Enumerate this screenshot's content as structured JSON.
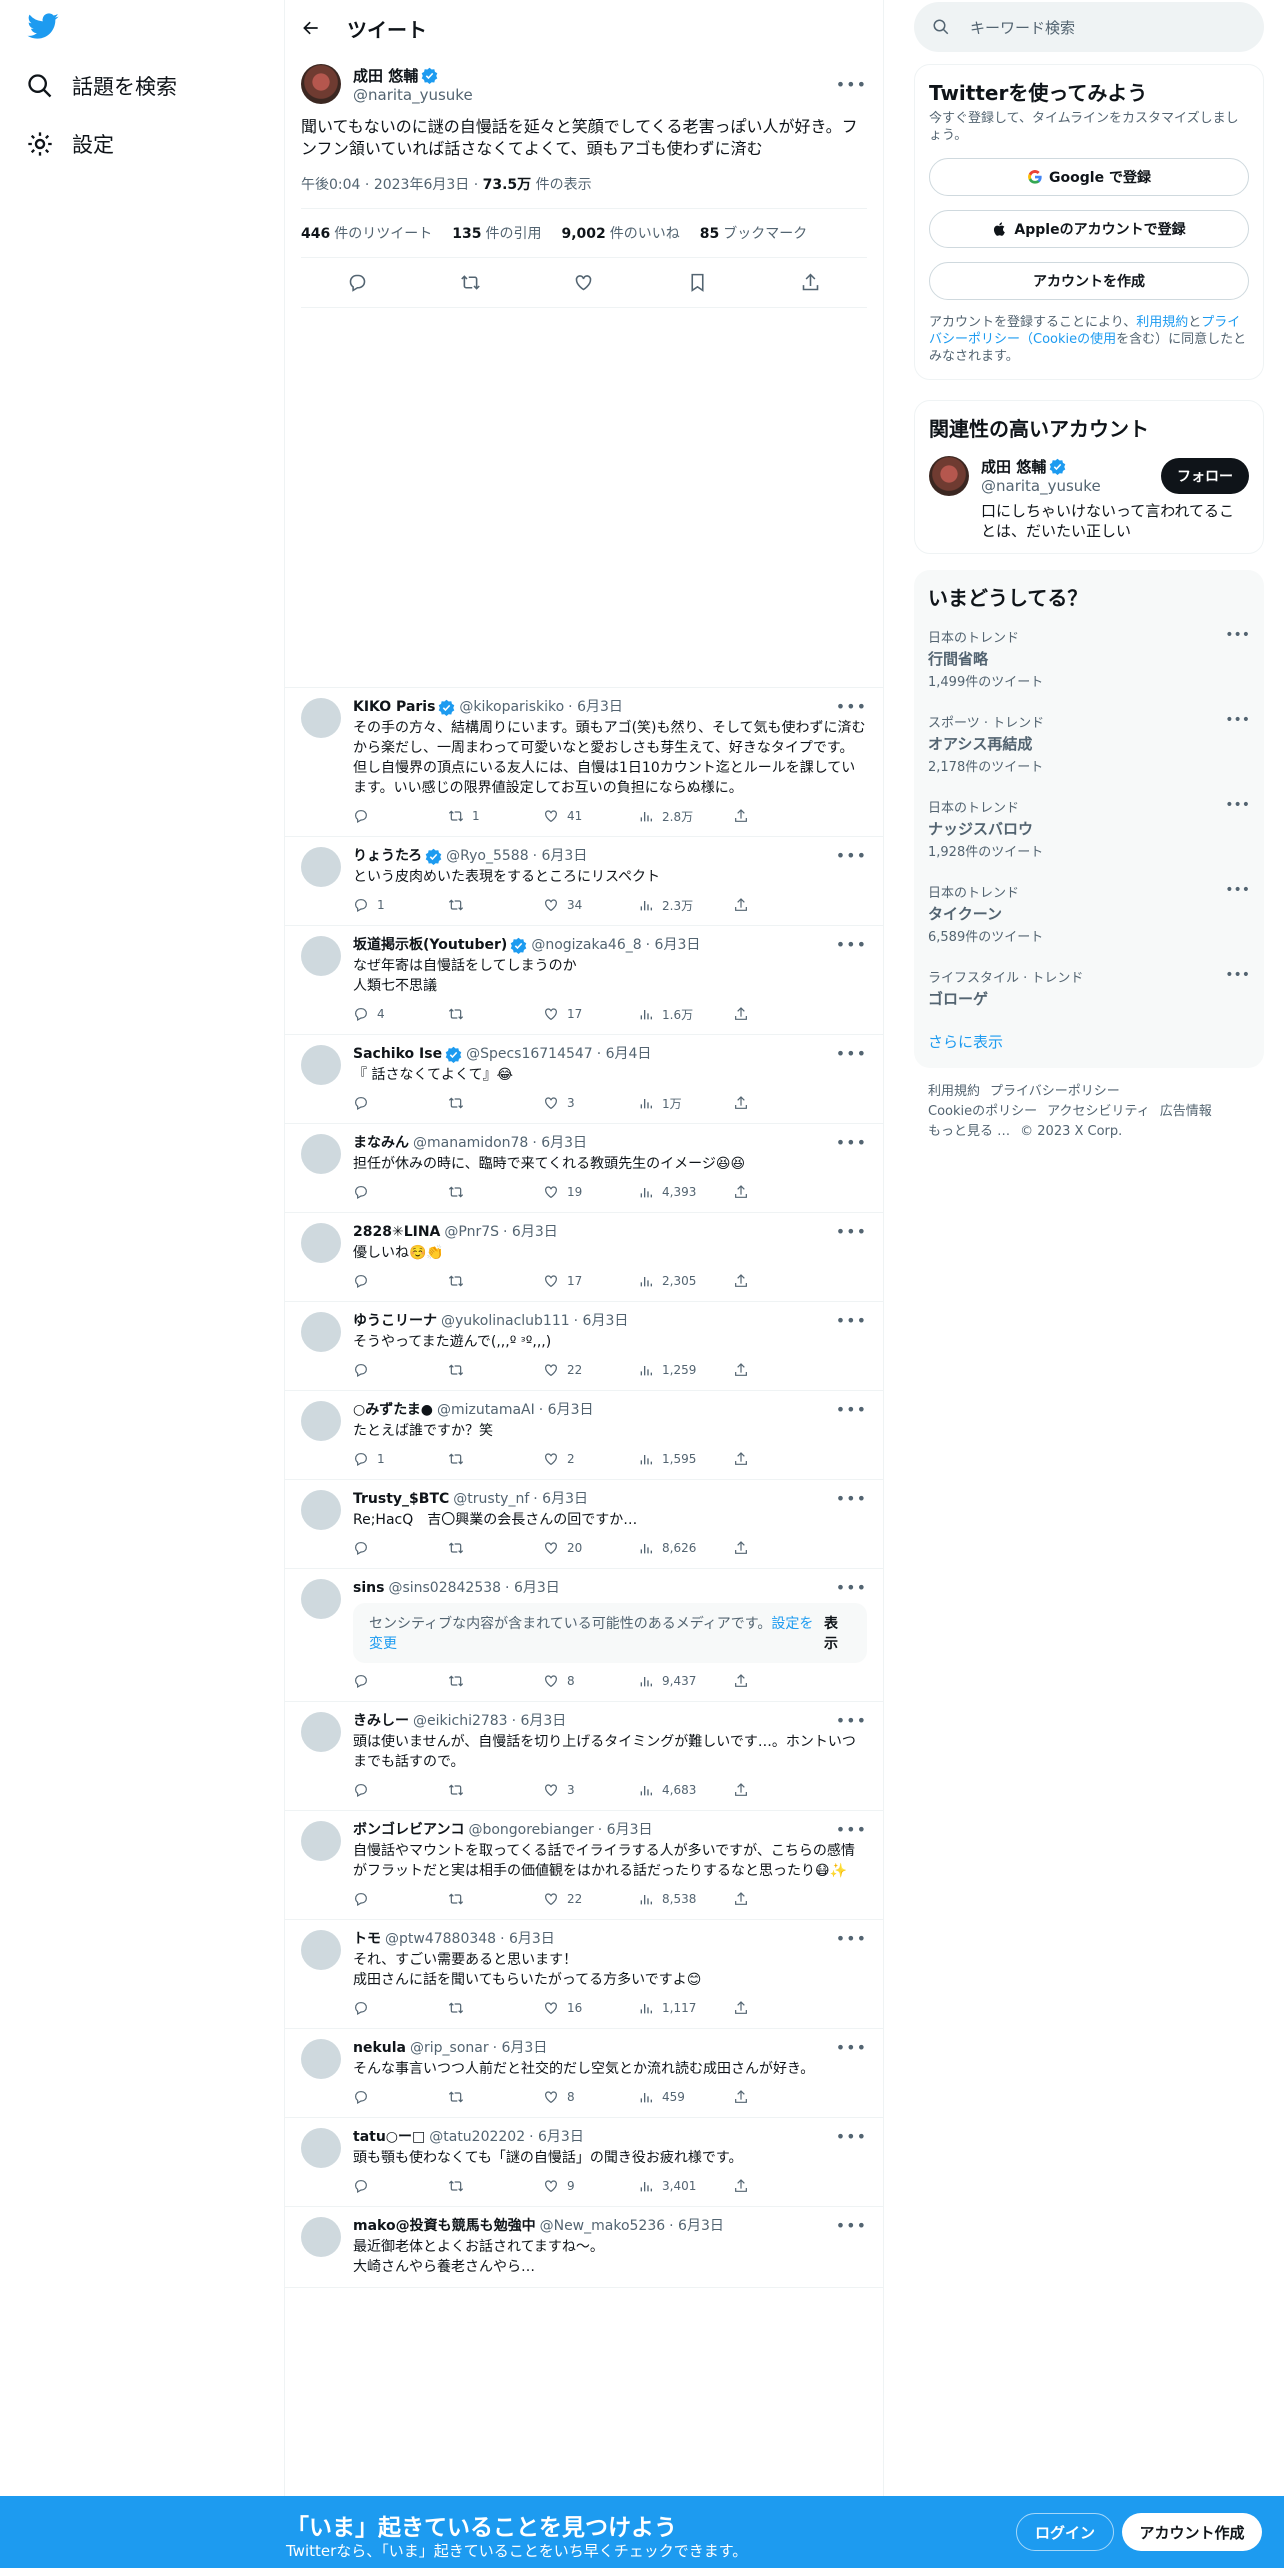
{
  "nav": {
    "explore": "話題を検索",
    "settings": "設定"
  },
  "header": {
    "title": "ツイート"
  },
  "tweet": {
    "name": "成田 悠輔",
    "handle": "@narita_yusuke",
    "text": "聞いてもないのに謎の自慢話を延々と笑顔でしてくる老害っぽい人が好き。フンフン頷いていれば話さなくてよくて、頭もアゴも使わずに済む",
    "time": "午後0:04",
    "date": "2023年6月3日",
    "views": "73.5万",
    "views_label": "件の表示",
    "retweets": "446",
    "retweets_label": "件のリツイート",
    "quotes": "135",
    "quotes_label": "件の引用",
    "likes": "9,002",
    "likes_label": "件のいいね",
    "bookmarks": "85",
    "bookmarks_label": "ブックマーク"
  },
  "replies": [
    {
      "name": "KIKO Paris",
      "verified": true,
      "handle": "@kikopariskiko",
      "date": "· 6月3日",
      "text": "その手の方々、結構周りにいます。頭もアゴ(笑)も然り、そして気も使わずに済むから楽だし、一周まわって可愛いなと愛おしさも芽生えて、好きなタイプです。\n但し自慢界の頂点にいる友人には、自慢は1日10カウント迄とルールを課しています。いい感じの限界値設定してお互いの負担にならぬ様に。",
      "replies": "",
      "retweets": "1",
      "likes": "41",
      "views": "2.8万"
    },
    {
      "name": "りょうたろ",
      "verified": true,
      "handle": "@Ryo_5588",
      "date": "· 6月3日",
      "text": "という皮肉めいた表現をするところにリスペクト",
      "replies": "1",
      "retweets": "",
      "likes": "34",
      "views": "2.3万"
    },
    {
      "name": "坂道掲示板(Youtuber)",
      "verified": true,
      "handle": "@nogizaka46_8",
      "date": "· 6月3日",
      "text": "なぜ年寄は自慢話をしてしまうのか\n人類七不思議",
      "replies": "4",
      "retweets": "",
      "likes": "17",
      "views": "1.6万"
    },
    {
      "name": "Sachiko Ise",
      "verified": true,
      "handle": "@Specs16714547",
      "date": "· 6月4日",
      "text": "『 話さなくてよくて』😂",
      "replies": "",
      "retweets": "",
      "likes": "3",
      "views": "1万"
    },
    {
      "name": "まなみん",
      "verified": false,
      "handle": "@manamidon78",
      "date": "· 6月3日",
      "text": "担任が休みの時に、臨時で来てくれる教頭先生のイメージ😆😆",
      "replies": "",
      "retweets": "",
      "likes": "19",
      "views": "4,393"
    },
    {
      "name": "2828✳LINA",
      "verified": false,
      "handle": "@Pnr7S",
      "date": "· 6月3日",
      "text": "優しいね☺️👏",
      "replies": "",
      "retweets": "",
      "likes": "17",
      "views": "2,305"
    },
    {
      "name": "ゆうこリーナ",
      "verified": false,
      "handle": "@yukolinaclub111",
      "date": "· 6月3日",
      "text": "そうやってまた遊んで(,,,º ᵌº,,,)",
      "replies": "",
      "retweets": "",
      "likes": "22",
      "views": "1,259"
    },
    {
      "name": "○みずたま●",
      "verified": false,
      "handle": "@mizutamaAI",
      "date": "· 6月3日",
      "text": "たとえば誰ですか？笑",
      "replies": "1",
      "retweets": "",
      "likes": "2",
      "views": "1,595"
    },
    {
      "name": "Trusty_$BTC",
      "verified": false,
      "handle": "@trusty_nf",
      "date": "· 6月3日",
      "text": "Re;HacQ　吉〇興業の会長さんの回ですか…",
      "replies": "",
      "retweets": "",
      "likes": "20",
      "views": "8,626"
    },
    {
      "name": "sins",
      "verified": false,
      "handle": "@sins02842538",
      "date": "· 6月3日",
      "text": "",
      "sensitive": {
        "text1": "センシティブな内容が含まれている可能性のあるメディアです。",
        "link": "設定を変更",
        "show": "表示"
      },
      "replies": "",
      "retweets": "",
      "likes": "8",
      "views": "9,437"
    },
    {
      "name": "きみしー",
      "verified": false,
      "handle": "@eikichi2783",
      "date": "· 6月3日",
      "text": "頭は使いませんが、自慢話を切り上げるタイミングが難しいです…。ホントいつまでも話すので。",
      "replies": "",
      "retweets": "",
      "likes": "3",
      "views": "4,683"
    },
    {
      "name": "ボンゴレビアンコ",
      "verified": false,
      "handle": "@bongorebianger",
      "date": "· 6月3日",
      "text": "自慢話やマウントを取ってくる話でイライラする人が多いですが、こちらの感情がフラットだと実は相手の価値観をはかれる話だったりするなと思ったり😷✨",
      "replies": "",
      "retweets": "",
      "likes": "22",
      "views": "8,538"
    },
    {
      "name": "トモ",
      "verified": false,
      "handle": "@ptw47880348",
      "date": "· 6月3日",
      "text": "それ、すごい需要あると思います！\n成田さんに話を聞いてもらいたがってる方多いですよ😊",
      "replies": "",
      "retweets": "",
      "likes": "16",
      "views": "1,117"
    },
    {
      "name": "nekula",
      "verified": false,
      "handle": "@rip_sonar",
      "date": "· 6月3日",
      "text": "そんな事言いつつ人前だと社交的だし空気とか流れ読む成田さんが好き。",
      "replies": "",
      "retweets": "",
      "likes": "8",
      "views": "459"
    },
    {
      "name": "tatu○ー□",
      "verified": false,
      "handle": "@tatu202202",
      "date": "· 6月3日",
      "text": "頭も顎も使わなくても「謎の自慢話」の聞き役お疲れ様です。",
      "replies": "",
      "retweets": "",
      "likes": "9",
      "views": "3,401"
    },
    {
      "name": "mako@投資も競馬も勉強中",
      "verified": false,
      "handle": "@New_mako5236",
      "date": "· 6月3日",
      "text": "最近御老体とよくお話されてますね〜。\n大崎さんやら養老さんやら…",
      "replies": "",
      "retweets": "",
      "likes": "",
      "views": ""
    }
  ],
  "sidebar": {
    "search_placeholder": "キーワード検索",
    "signup": {
      "title": "Twitterを使ってみよう",
      "subtitle": "今すぐ登録して、タイムラインをカスタマイズしましょう。",
      "google": "Google で登録",
      "apple": "Appleのアカウントで登録",
      "create": "アカウントを作成",
      "legal_1": "アカウントを登録することにより、",
      "legal_terms": "利用規約",
      "legal_2": "と",
      "legal_privacy": "プライバシーポリシー（Cookieの使用",
      "legal_3": "を含む）に同意したとみなされます。"
    },
    "related": {
      "title": "関連性の高いアカウント",
      "name": "成田 悠輔",
      "handle": "@narita_yusuke",
      "follow": "フォロー",
      "bio": "口にしちゃいけないって言われてることは、だいたい正しい"
    },
    "trends": {
      "title": "いまどうしてる？",
      "items": [
        {
          "category": "日本のトレンド",
          "name": "行間省略",
          "count": "1,499件のツイート"
        },
        {
          "category": "スポーツ · トレンド",
          "name": "オアシス再結成",
          "count": "2,178件のツイート"
        },
        {
          "category": "日本のトレンド",
          "name": "ナッジスバロウ",
          "count": "1,928件のツイート"
        },
        {
          "category": "日本のトレンド",
          "name": "タイクーン",
          "count": "6,589件のツイート"
        },
        {
          "category": "ライフスタイル · トレンド",
          "name": "ゴローゲ",
          "count": ""
        }
      ],
      "show_more": "さらに表示"
    },
    "footer": {
      "terms": "利用規約",
      "privacy": "プライバシーポリシー",
      "cookie": "Cookieのポリシー",
      "accessibility": "アクセシビリティ",
      "ads": "広告情報",
      "more": "もっと見る …",
      "copyright": "© 2023 X Corp."
    }
  },
  "banner": {
    "title": "「いま」起きていることを見つけよう",
    "subtitle": "Twitterなら、「いま」起きていることをいち早くチェックできます。",
    "login": "ログイン",
    "signup": "アカウント作成"
  },
  "colors": {
    "accent": "#1d9bf0",
    "text": "#0f1419",
    "secondary": "#536471"
  }
}
